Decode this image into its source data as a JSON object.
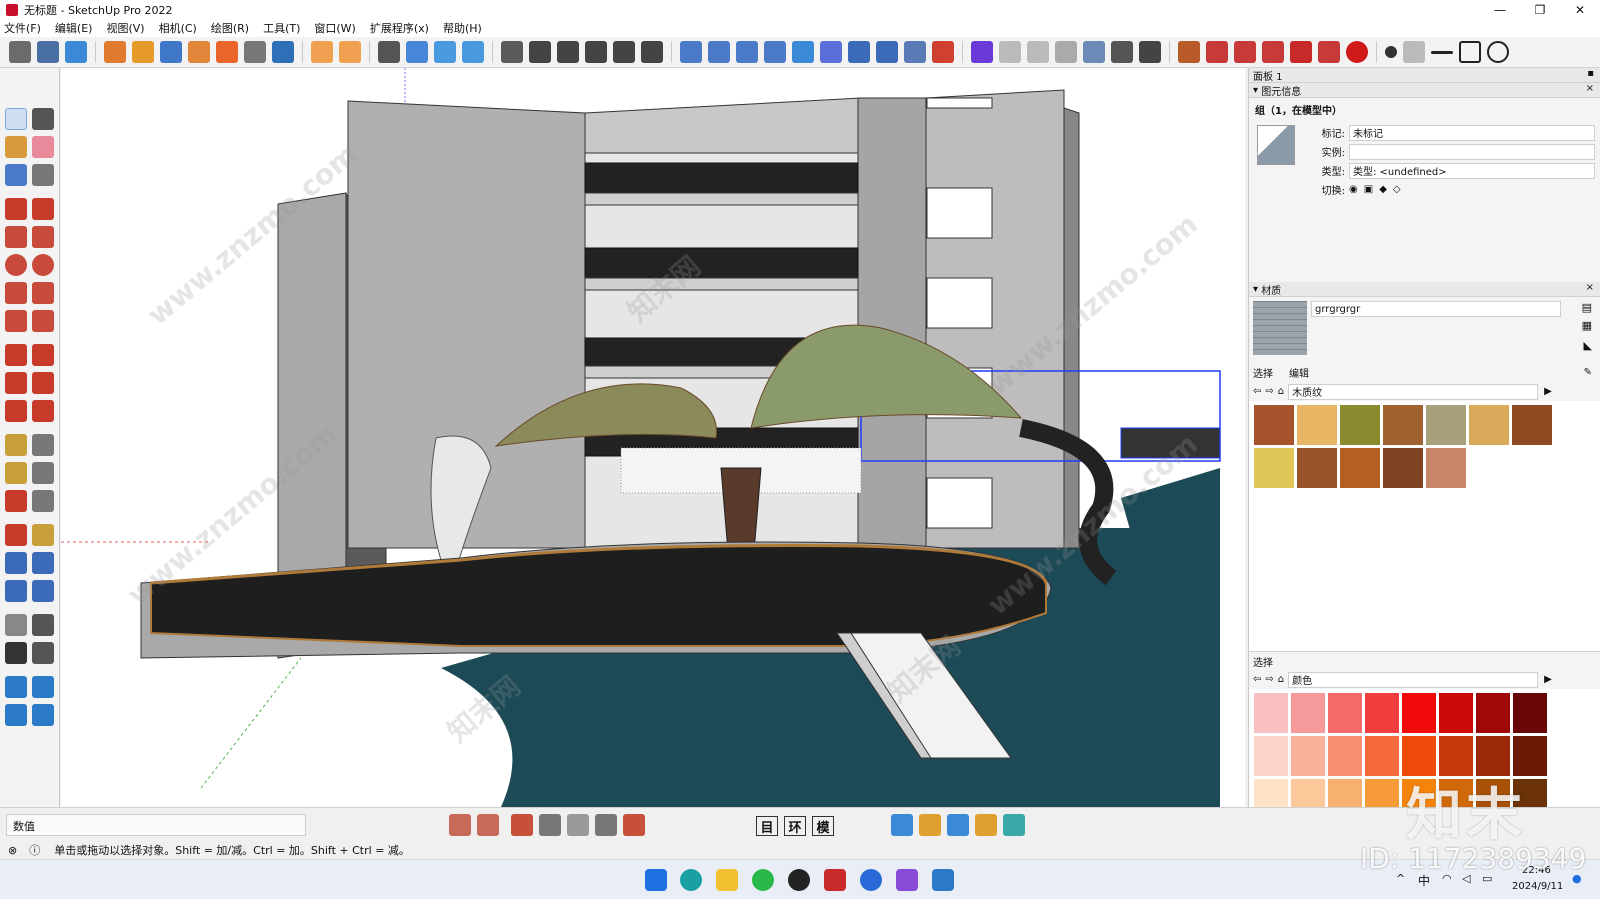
{
  "window": {
    "title": "无标题 - SketchUp Pro 2022",
    "minimize": "—",
    "maximize": "❐",
    "close": "✕"
  },
  "menu": [
    "文件(F)",
    "编辑(E)",
    "视图(V)",
    "相机(C)",
    "绘图(R)",
    "工具(T)",
    "窗口(W)",
    "扩展程序(x)",
    "帮助(H)"
  ],
  "panel": {
    "title": "面板 1",
    "entity_info": {
      "header": "图元信息",
      "selection": "组（1，在模型中）",
      "tag_label": "标记:",
      "tag_value": "未标记",
      "instance_label": "实例:",
      "instance_value": "",
      "type_label": "类型:",
      "type_value": "类型:  <undefined>",
      "toggle_label": "切换:"
    },
    "materials": {
      "header": "材质",
      "material_name": "grrgrgrgr",
      "tab_select": "选择",
      "tab_edit": "编辑",
      "library": "木质纹",
      "wood_colors": [
        "#a5532a",
        "#e8b564",
        "#8a8a2e",
        "#a0622f",
        "#a8a07a",
        "#d8aa5a",
        "#8e4a21",
        "#e1c75a",
        "#9a5228",
        "#b45f24",
        "#7e4320",
        "#c8856a"
      ],
      "select_label": "选择",
      "color_library": "颜色",
      "color_swatches": [
        "#f8c0c0",
        "#f59a9a",
        "#f56b6b",
        "#f03e3e",
        "#f00a0a",
        "#cc0a0a",
        "#9e0808",
        "#6a0606",
        "#fbd3c8",
        "#f8b29a",
        "#f69070",
        "#f56a3a",
        "#f04a0a",
        "#c53a0a",
        "#9a2a08",
        "#6a1a06",
        "#fde2c8",
        "#fbc99a",
        "#f8b070",
        "#f69a3a",
        "#f5840a",
        "#d1690a",
        "#a85208",
        "#6a3206",
        "#fff0d8",
        "#ffe0a0",
        "#ffd060"
      ]
    }
  },
  "status": {
    "measurement_label": "数值",
    "view_buttons": [
      "目",
      "环",
      "模"
    ],
    "hint": "单击或拖动以选择对象。Shift = 加/减。Ctrl = 加。Shift + Ctrl = 减。"
  },
  "taskbar": {
    "time": "22:46",
    "date": "2024/9/11",
    "ime": "中"
  },
  "watermark": {
    "site": "www.znzmo.com",
    "brand_cn": "知末",
    "brand_wm": "知末网",
    "id_label": "ID: 1172389349"
  },
  "colors": {
    "water": "#1c4a57",
    "building": "#a9a9a9",
    "selection_blue": "#1e3cff",
    "accent_red": "#c8102e"
  }
}
